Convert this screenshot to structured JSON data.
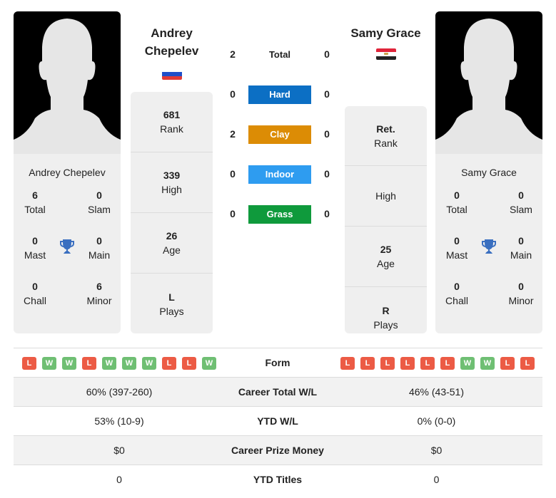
{
  "player_left": {
    "name": "Andrey Chepelev",
    "name_line1": "Andrey",
    "name_line2": "Chepelev",
    "flag": "russia-flag",
    "flag_colors": [
      "#ffffff",
      "#1f4fc9",
      "#e23b36"
    ],
    "card_name": "Andrey Chepelev",
    "titles": {
      "total": {
        "value": "6",
        "label": "Total"
      },
      "slam": {
        "value": "0",
        "label": "Slam"
      },
      "mast": {
        "value": "0",
        "label": "Mast"
      },
      "main": {
        "value": "0",
        "label": "Main"
      },
      "chall": {
        "value": "0",
        "label": "Chall"
      },
      "minor": {
        "value": "6",
        "label": "Minor"
      }
    },
    "stats": [
      {
        "value": "681",
        "label": "Rank"
      },
      {
        "value": "339",
        "label": "High"
      },
      {
        "value": "26",
        "label": "Age"
      },
      {
        "value": "L",
        "label": "Plays"
      }
    ],
    "form": [
      "L",
      "W",
      "W",
      "L",
      "W",
      "W",
      "W",
      "L",
      "L",
      "W"
    ]
  },
  "player_right": {
    "name": "Samy Grace",
    "flag": "egypt-flag",
    "flag_colors": [
      "#e0243a",
      "#ffffff",
      "#222222"
    ],
    "card_name": "Samy Grace",
    "titles": {
      "total": {
        "value": "0",
        "label": "Total"
      },
      "slam": {
        "value": "0",
        "label": "Slam"
      },
      "mast": {
        "value": "0",
        "label": "Mast"
      },
      "main": {
        "value": "0",
        "label": "Main"
      },
      "chall": {
        "value": "0",
        "label": "Chall"
      },
      "minor": {
        "value": "0",
        "label": "Minor"
      }
    },
    "stats": [
      {
        "value": "Ret.",
        "label": "Rank"
      },
      {
        "value": "",
        "label": "High"
      },
      {
        "value": "25",
        "label": "Age"
      },
      {
        "value": "R",
        "label": "Plays"
      }
    ],
    "form": [
      "L",
      "L",
      "L",
      "L",
      "L",
      "L",
      "W",
      "W",
      "L",
      "L"
    ]
  },
  "head_to_head": [
    {
      "label": "Total",
      "left": "2",
      "right": "0",
      "color": ""
    },
    {
      "label": "Hard",
      "left": "0",
      "right": "0",
      "color": "#0c6fc4"
    },
    {
      "label": "Clay",
      "left": "2",
      "right": "0",
      "color": "#dc8c05"
    },
    {
      "label": "Indoor",
      "left": "0",
      "right": "0",
      "color": "#2e9cf0"
    },
    {
      "label": "Grass",
      "left": "0",
      "right": "0",
      "color": "#0f9a3c"
    }
  ],
  "comparison": {
    "form_label": "Form",
    "rows": [
      {
        "label": "Career Total W/L",
        "left": "60% (397-260)",
        "right": "46% (43-51)"
      },
      {
        "label": "YTD W/L",
        "left": "53% (10-9)",
        "right": "0% (0-0)"
      },
      {
        "label": "Career Prize Money",
        "left": "$0",
        "right": "$0"
      },
      {
        "label": "YTD Titles",
        "left": "0",
        "right": "0"
      }
    ]
  },
  "colors": {
    "win": "#6fbf73",
    "loss": "#ec5b45",
    "trophy": "#3a6fc0",
    "card_bg": "#efefef"
  }
}
